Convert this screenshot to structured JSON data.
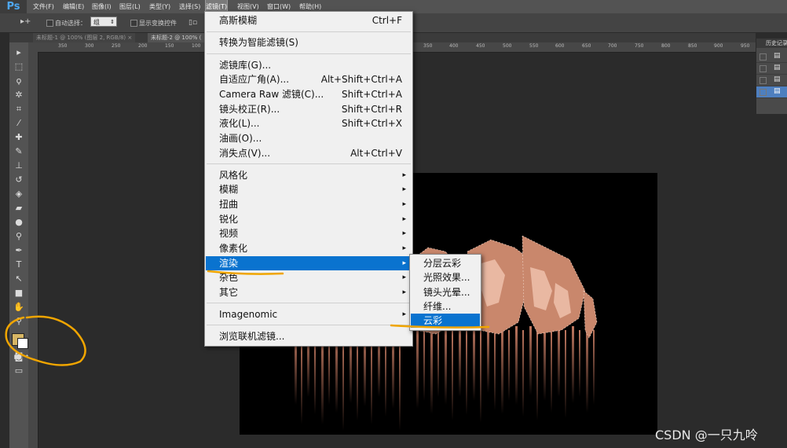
{
  "app": {
    "logo": "Ps"
  },
  "menubar": {
    "items": [
      "文件(F)",
      "编辑(E)",
      "图像(I)",
      "图层(L)",
      "类型(Y)",
      "选择(S)",
      "滤镜(T)",
      "视图(V)",
      "窗口(W)",
      "帮助(H)"
    ],
    "active_index": 6
  },
  "options": {
    "auto_select_label": "自动选择：",
    "auto_select_value": "组",
    "show_transform_label": "显示变换控件"
  },
  "tabs": [
    {
      "label": "未标题-1 @ 100% (图层 2, RGB/8)",
      "close": "×"
    },
    {
      "label": "未标题-2 @ 100% (",
      "close": ""
    }
  ],
  "ruler": {
    "labels_left": [
      "350",
      "300",
      "250",
      "200",
      "150",
      "100"
    ],
    "labels_right": [
      "350",
      "400",
      "450",
      "500",
      "550",
      "600",
      "650",
      "700",
      "750",
      "800",
      "850",
      "900",
      "950"
    ]
  },
  "filter_menu": {
    "items": [
      {
        "label": "高斯模糊",
        "shortcut": "Ctrl+F"
      },
      {
        "label": "转换为智能滤镜(S)"
      },
      {
        "label": "滤镜库(G)..."
      },
      {
        "label": "自适应广角(A)...",
        "shortcut": "Alt+Shift+Ctrl+A"
      },
      {
        "label": "Camera Raw 滤镜(C)...",
        "shortcut": "Shift+Ctrl+A"
      },
      {
        "label": "镜头校正(R)...",
        "shortcut": "Shift+Ctrl+R"
      },
      {
        "label": "液化(L)...",
        "shortcut": "Shift+Ctrl+X"
      },
      {
        "label": "油画(O)..."
      },
      {
        "label": "消失点(V)...",
        "shortcut": "Alt+Ctrl+V"
      },
      {
        "label": "风格化",
        "submenu": true
      },
      {
        "label": "模糊",
        "submenu": true
      },
      {
        "label": "扭曲",
        "submenu": true
      },
      {
        "label": "锐化",
        "submenu": true
      },
      {
        "label": "视频",
        "submenu": true
      },
      {
        "label": "像素化",
        "submenu": true
      },
      {
        "label": "渲染",
        "submenu": true,
        "highlighted": true
      },
      {
        "label": "杂色",
        "submenu": true
      },
      {
        "label": "其它",
        "submenu": true
      },
      {
        "label": "Imagenomic",
        "submenu": true
      },
      {
        "label": "浏览联机滤镜..."
      }
    ],
    "arrow": "▸"
  },
  "render_submenu": {
    "items": [
      {
        "label": "分层云彩"
      },
      {
        "label": "光照效果..."
      },
      {
        "label": "镜头光晕..."
      },
      {
        "label": "纤维..."
      },
      {
        "label": "云彩",
        "highlighted": true
      }
    ]
  },
  "history_panel": {
    "title": "历史记录"
  },
  "colors": {
    "foreground": "#d7b664",
    "background": "#ffffff",
    "highlight": "#0a73cf",
    "annotation": "#f0a500"
  },
  "watermark": "CSDN @一只九呤"
}
